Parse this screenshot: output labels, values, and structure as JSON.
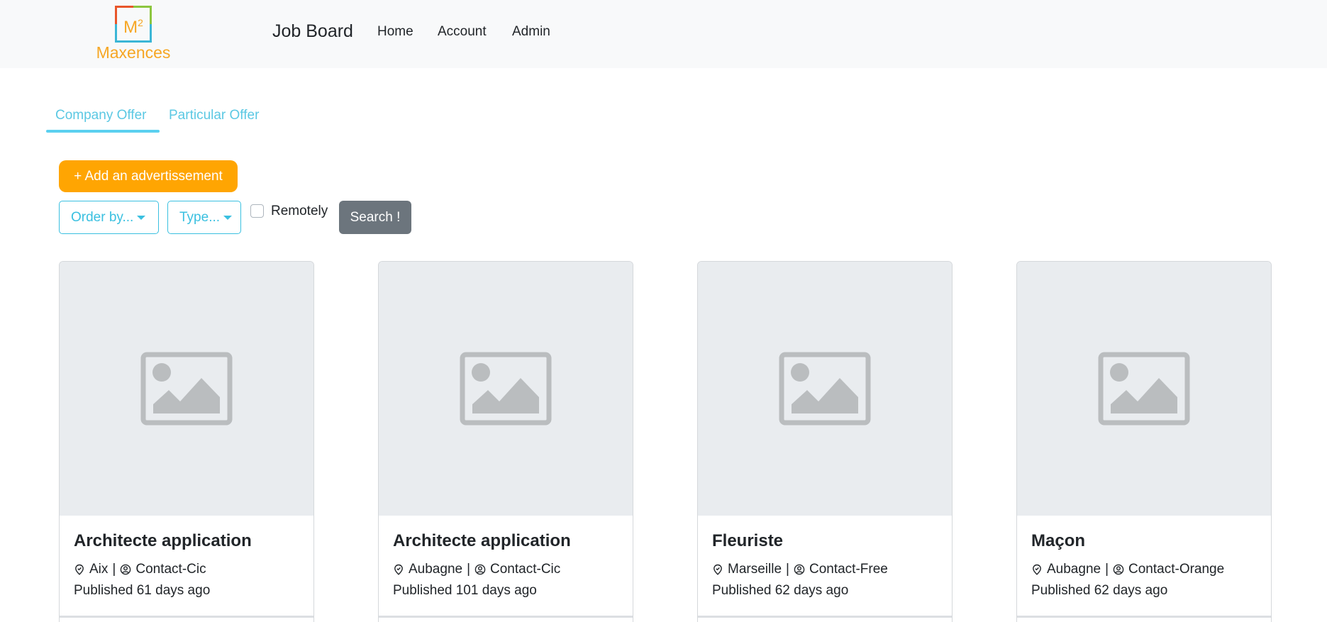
{
  "navbar": {
    "logo_text": "Maxences",
    "logo_glyph": "M",
    "logo_sup": "2",
    "brand": "Job Board",
    "links": [
      "Home",
      "Account",
      "Admin"
    ]
  },
  "tabs": [
    {
      "label": "Company Offer",
      "active": true
    },
    {
      "label": "Particular Offer",
      "active": false
    }
  ],
  "toolbar": {
    "add_label": "+ Add an advertissement",
    "order_label": "Order by...",
    "type_label": "Type...",
    "remote_label": "Remotely",
    "search_label": "Search !"
  },
  "cards": [
    {
      "title": "Architecte application",
      "city": "Aix",
      "contact": "Contact-Cic",
      "published": "Published 61 days ago"
    },
    {
      "title": "Architecte application",
      "city": "Aubagne",
      "contact": "Contact-Cic",
      "published": "Published 101 days ago"
    },
    {
      "title": "Fleuriste",
      "city": "Marseille",
      "contact": "Contact-Free",
      "published": "Published 62 days ago"
    },
    {
      "title": "Maçon",
      "city": "Aubagne",
      "contact": "Contact-Orange",
      "published": "Published 62 days ago"
    }
  ],
  "colors": {
    "accent": "#3ac0e0",
    "add_button": "#ffa502",
    "search_button": "#6c757d",
    "placeholder_bg": "#e9ecef",
    "placeholder_icon": "#babdbf"
  },
  "icons": {
    "card_image": "image-placeholder-icon",
    "location": "location-pin-icon",
    "contact": "user-circle-icon"
  }
}
